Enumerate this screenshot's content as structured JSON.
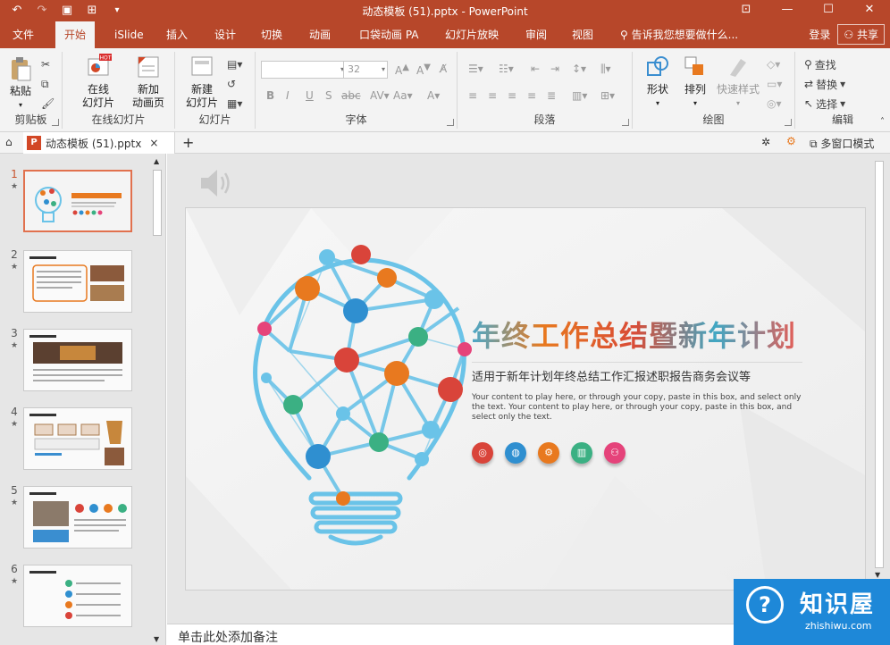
{
  "window": {
    "title": "动态模板 (51).pptx - PowerPoint"
  },
  "ribbon_tabs": [
    "文件",
    "开始",
    "iSlide",
    "插入",
    "设计",
    "切换",
    "动画",
    "口袋动画 PA",
    "幻灯片放映",
    "审阅",
    "视图"
  ],
  "active_tab": "开始",
  "tell_me": "告诉我您想要做什么...",
  "account": {
    "login": "登录",
    "share": "共享"
  },
  "groups": {
    "clipboard": {
      "name": "剪贴板",
      "paste": "粘贴"
    },
    "online": {
      "name": "在线幻灯片",
      "online_slide": "在线\n幻灯片",
      "new_anim": "新加\n动画页",
      "hot": "HOT"
    },
    "slides": {
      "name": "幻灯片",
      "new_slide": "新建\n幻灯片"
    },
    "font": {
      "name": "字体",
      "font_size": "32"
    },
    "paragraph": {
      "name": "段落"
    },
    "drawing": {
      "name": "绘图",
      "shapes": "形状",
      "arrange": "排列",
      "quick_styles": "快速样式"
    },
    "editing": {
      "name": "编辑",
      "find": "查找",
      "replace": "替换",
      "select": "选择"
    }
  },
  "doc_tab": {
    "name": "动态模板 (51).pptx",
    "close": "×",
    "add": "+",
    "multi_window": "多窗口模式"
  },
  "slides": [
    {
      "num": "1",
      "star": "★",
      "selected": true
    },
    {
      "num": "2",
      "star": "★",
      "selected": false
    },
    {
      "num": "3",
      "star": "★",
      "selected": false
    },
    {
      "num": "4",
      "star": "★",
      "selected": false
    },
    {
      "num": "5",
      "star": "★",
      "selected": false
    },
    {
      "num": "6",
      "star": "★",
      "selected": false
    }
  ],
  "slide": {
    "title": "年终工作总结暨新年计划",
    "subtitle": "适用于新年计划年终总结工作汇报述职报告商务会议等",
    "body": "Your content to play here, or through your copy, paste in this box, and select only the text. Your content to play here, or through your copy, paste in this box, and select only the text."
  },
  "notes_placeholder": "单击此处添加备注",
  "watermark": {
    "name": "知识屋",
    "domain": "zhishiwu.com"
  },
  "colors": {
    "accent": "#b7472a",
    "blue": "#6ac3e8",
    "orange": "#e8791f",
    "red": "#d9443a",
    "green": "#3bb083",
    "pink": "#e5437a",
    "darkblue": "#2f8fd0"
  }
}
